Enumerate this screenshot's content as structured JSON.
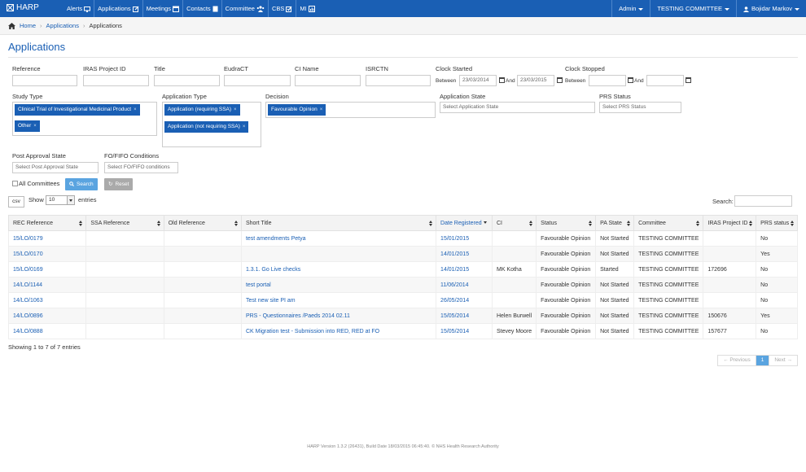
{
  "topbar": {
    "brand": "HARP",
    "nav": [
      {
        "label": "Alerts",
        "icon": "monitor-icon"
      },
      {
        "label": "Applications",
        "icon": "edit-icon"
      },
      {
        "label": "Meetings",
        "icon": "calendar-icon"
      },
      {
        "label": "Contacts",
        "icon": "book-icon"
      },
      {
        "label": "Committee",
        "icon": "users-icon"
      },
      {
        "label": "CBS",
        "icon": "check-icon"
      },
      {
        "label": "MI",
        "icon": "bar-chart-icon"
      }
    ],
    "admin": "Admin",
    "committee": "TESTING COMMITTEE",
    "user": "Bojidar Markov"
  },
  "breadcrumb": {
    "home": "Home",
    "applications": "Applications",
    "current": "Applications"
  },
  "page_title": "Applications",
  "filters": {
    "reference": "Reference",
    "iras": "IRAS Project ID",
    "title": "Title",
    "eudract": "EudraCT",
    "ci_name": "CI Name",
    "isrctn": "ISRCTN",
    "clock_started": "Clock Started",
    "clock_stopped": "Clock Stopped",
    "between": "Between",
    "and": "And",
    "clock_started_from": "23/03/2014",
    "clock_started_to": "23/03/2015",
    "study_type": "Study Type",
    "study_type_tags": [
      "Clinical Trial of Investigational Medicinal Product",
      "Other"
    ],
    "application_type": "Application Type",
    "application_type_tags": [
      "Application (requiring SSA)",
      "Application (not requiring SSA)"
    ],
    "decision": "Decision",
    "decision_tags": [
      "Favourable Opinion"
    ],
    "application_state": "Application State",
    "application_state_placeholder": "Select Application State",
    "prs_status": "PRS Status",
    "prs_status_placeholder": "Select PRS Status",
    "post_approval_state": "Post Approval State",
    "post_approval_placeholder": "Select Post Approval State",
    "fo_fifo": "FO/FIFO Conditions",
    "fo_fifo_placeholder": "Select FO/FIFO conditions",
    "all_committees": "All Committees",
    "search_btn": "Search",
    "reset_btn": "Reset"
  },
  "table_controls": {
    "csv": "csv",
    "show": "Show",
    "page_size": "10",
    "entries": "entries",
    "search": "Search:"
  },
  "table": {
    "headers": [
      "REC Reference",
      "SSA Reference",
      "Old Reference",
      "Short Title",
      "Date Registered",
      "CI",
      "Status",
      "PA State",
      "Committee",
      "IRAS Project ID",
      "PRS status"
    ],
    "rows": [
      [
        "15/LO/0179",
        "",
        "",
        "test amendments Petya",
        "15/01/2015",
        "",
        "Favourable Opinion",
        "Not Started",
        "TESTING COMMITTEE",
        "",
        "No"
      ],
      [
        "15/LO/0170",
        "",
        "",
        "",
        "14/01/2015",
        "",
        "Favourable Opinion",
        "Not Started",
        "TESTING COMMITTEE",
        "",
        "Yes"
      ],
      [
        "15/LO/0169",
        "",
        "",
        "1.3.1. Go Live checks",
        "14/01/2015",
        "MK Kotha",
        "Favourable Opinion",
        "Started",
        "TESTING COMMITTEE",
        "172696",
        "No"
      ],
      [
        "14/LO/1144",
        "",
        "",
        "test portal",
        "11/06/2014",
        "",
        "Favourable Opinion",
        "Not Started",
        "TESTING COMMITTEE",
        "",
        "No"
      ],
      [
        "14/LO/1063",
        "",
        "",
        "Test new site PI am",
        "26/05/2014",
        "",
        "Favourable Opinion",
        "Not Started",
        "TESTING COMMITTEE",
        "",
        "No"
      ],
      [
        "14/LO/0896",
        "",
        "",
        "PRS - Questionnaires /Paeds 2014 02.11",
        "15/05/2014",
        "Helen Burwell",
        "Favourable Opinion",
        "Not Started",
        "TESTING COMMITTEE",
        "150676",
        "Yes"
      ],
      [
        "14/LO/0888",
        "",
        "",
        "CK Migration test - Submission into RED, RED at FO",
        "15/05/2014",
        "Stevey Moore",
        "Favourable Opinion",
        "Not Started",
        "TESTING COMMITTEE",
        "157677",
        "No"
      ]
    ]
  },
  "info": "Showing 1 to 7 of 7 entries",
  "pager": {
    "prev": "← Previous",
    "page": "1",
    "next": "Next →"
  },
  "footer": "HARP Version 1.3.2 (26431), Build Date 18/03/2015 06:45:40. © NHS Health Research Authority",
  "colors": {
    "brand": "#1a5fb4",
    "button": "#5aa4e0"
  }
}
